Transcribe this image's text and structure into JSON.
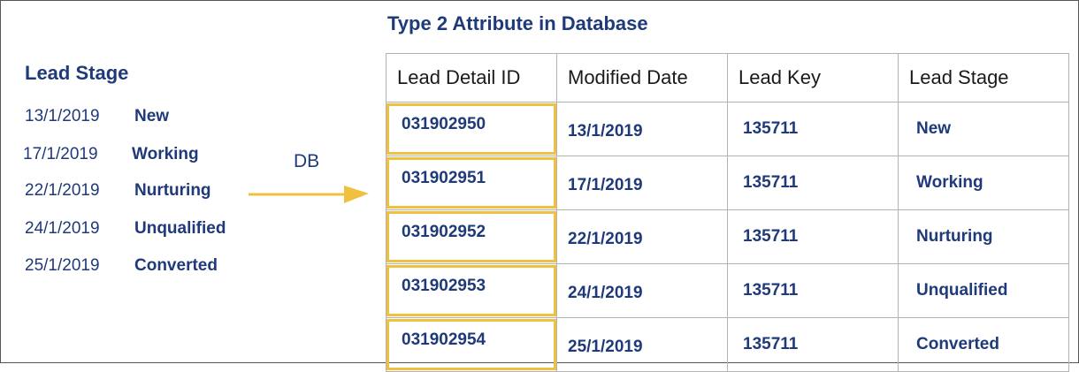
{
  "title": "Type 2 Attribute in Database",
  "lead_stage_panel": {
    "heading": "Lead Stage",
    "items": [
      {
        "date": "13/1/2019",
        "stage": "New"
      },
      {
        "date": "17/1/2019",
        "stage": "Working"
      },
      {
        "date": "22/1/2019",
        "stage": "Nurturing"
      },
      {
        "date": "24/1/2019",
        "stage": "Unqualified"
      },
      {
        "date": "25/1/2019",
        "stage": "Converted"
      }
    ]
  },
  "arrow_label": "DB",
  "table": {
    "headers": [
      "Lead Detail ID",
      "Modified Date",
      "Lead Key",
      "Lead Stage"
    ],
    "rows": [
      [
        "031902950",
        "13/1/2019",
        "135711",
        "New"
      ],
      [
        "031902951",
        "17/1/2019",
        "135711",
        "Working"
      ],
      [
        "031902952",
        "22/1/2019",
        "135711",
        "Nurturing"
      ],
      [
        "031902953",
        "24/1/2019",
        "135711",
        "Unqualified"
      ],
      [
        "031902954",
        "25/1/2019",
        "135711",
        "Converted"
      ]
    ]
  },
  "colors": {
    "heading": "#1f3a7a",
    "highlight": "#f0c040",
    "grid": "#b3b3b3"
  }
}
